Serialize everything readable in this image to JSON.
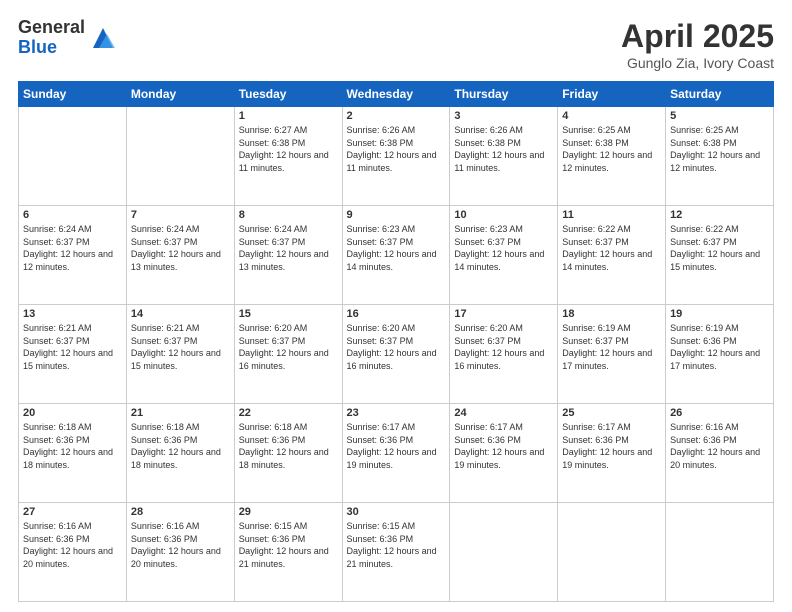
{
  "logo": {
    "general": "General",
    "blue": "Blue"
  },
  "header": {
    "month": "April 2025",
    "location": "Gunglo Zia, Ivory Coast"
  },
  "weekdays": [
    "Sunday",
    "Monday",
    "Tuesday",
    "Wednesday",
    "Thursday",
    "Friday",
    "Saturday"
  ],
  "weeks": [
    [
      {
        "day": "",
        "sunrise": "",
        "sunset": "",
        "daylight": ""
      },
      {
        "day": "",
        "sunrise": "",
        "sunset": "",
        "daylight": ""
      },
      {
        "day": "1",
        "sunrise": "Sunrise: 6:27 AM",
        "sunset": "Sunset: 6:38 PM",
        "daylight": "Daylight: 12 hours and 11 minutes."
      },
      {
        "day": "2",
        "sunrise": "Sunrise: 6:26 AM",
        "sunset": "Sunset: 6:38 PM",
        "daylight": "Daylight: 12 hours and 11 minutes."
      },
      {
        "day": "3",
        "sunrise": "Sunrise: 6:26 AM",
        "sunset": "Sunset: 6:38 PM",
        "daylight": "Daylight: 12 hours and 11 minutes."
      },
      {
        "day": "4",
        "sunrise": "Sunrise: 6:25 AM",
        "sunset": "Sunset: 6:38 PM",
        "daylight": "Daylight: 12 hours and 12 minutes."
      },
      {
        "day": "5",
        "sunrise": "Sunrise: 6:25 AM",
        "sunset": "Sunset: 6:38 PM",
        "daylight": "Daylight: 12 hours and 12 minutes."
      }
    ],
    [
      {
        "day": "6",
        "sunrise": "Sunrise: 6:24 AM",
        "sunset": "Sunset: 6:37 PM",
        "daylight": "Daylight: 12 hours and 12 minutes."
      },
      {
        "day": "7",
        "sunrise": "Sunrise: 6:24 AM",
        "sunset": "Sunset: 6:37 PM",
        "daylight": "Daylight: 12 hours and 13 minutes."
      },
      {
        "day": "8",
        "sunrise": "Sunrise: 6:24 AM",
        "sunset": "Sunset: 6:37 PM",
        "daylight": "Daylight: 12 hours and 13 minutes."
      },
      {
        "day": "9",
        "sunrise": "Sunrise: 6:23 AM",
        "sunset": "Sunset: 6:37 PM",
        "daylight": "Daylight: 12 hours and 14 minutes."
      },
      {
        "day": "10",
        "sunrise": "Sunrise: 6:23 AM",
        "sunset": "Sunset: 6:37 PM",
        "daylight": "Daylight: 12 hours and 14 minutes."
      },
      {
        "day": "11",
        "sunrise": "Sunrise: 6:22 AM",
        "sunset": "Sunset: 6:37 PM",
        "daylight": "Daylight: 12 hours and 14 minutes."
      },
      {
        "day": "12",
        "sunrise": "Sunrise: 6:22 AM",
        "sunset": "Sunset: 6:37 PM",
        "daylight": "Daylight: 12 hours and 15 minutes."
      }
    ],
    [
      {
        "day": "13",
        "sunrise": "Sunrise: 6:21 AM",
        "sunset": "Sunset: 6:37 PM",
        "daylight": "Daylight: 12 hours and 15 minutes."
      },
      {
        "day": "14",
        "sunrise": "Sunrise: 6:21 AM",
        "sunset": "Sunset: 6:37 PM",
        "daylight": "Daylight: 12 hours and 15 minutes."
      },
      {
        "day": "15",
        "sunrise": "Sunrise: 6:20 AM",
        "sunset": "Sunset: 6:37 PM",
        "daylight": "Daylight: 12 hours and 16 minutes."
      },
      {
        "day": "16",
        "sunrise": "Sunrise: 6:20 AM",
        "sunset": "Sunset: 6:37 PM",
        "daylight": "Daylight: 12 hours and 16 minutes."
      },
      {
        "day": "17",
        "sunrise": "Sunrise: 6:20 AM",
        "sunset": "Sunset: 6:37 PM",
        "daylight": "Daylight: 12 hours and 16 minutes."
      },
      {
        "day": "18",
        "sunrise": "Sunrise: 6:19 AM",
        "sunset": "Sunset: 6:37 PM",
        "daylight": "Daylight: 12 hours and 17 minutes."
      },
      {
        "day": "19",
        "sunrise": "Sunrise: 6:19 AM",
        "sunset": "Sunset: 6:36 PM",
        "daylight": "Daylight: 12 hours and 17 minutes."
      }
    ],
    [
      {
        "day": "20",
        "sunrise": "Sunrise: 6:18 AM",
        "sunset": "Sunset: 6:36 PM",
        "daylight": "Daylight: 12 hours and 18 minutes."
      },
      {
        "day": "21",
        "sunrise": "Sunrise: 6:18 AM",
        "sunset": "Sunset: 6:36 PM",
        "daylight": "Daylight: 12 hours and 18 minutes."
      },
      {
        "day": "22",
        "sunrise": "Sunrise: 6:18 AM",
        "sunset": "Sunset: 6:36 PM",
        "daylight": "Daylight: 12 hours and 18 minutes."
      },
      {
        "day": "23",
        "sunrise": "Sunrise: 6:17 AM",
        "sunset": "Sunset: 6:36 PM",
        "daylight": "Daylight: 12 hours and 19 minutes."
      },
      {
        "day": "24",
        "sunrise": "Sunrise: 6:17 AM",
        "sunset": "Sunset: 6:36 PM",
        "daylight": "Daylight: 12 hours and 19 minutes."
      },
      {
        "day": "25",
        "sunrise": "Sunrise: 6:17 AM",
        "sunset": "Sunset: 6:36 PM",
        "daylight": "Daylight: 12 hours and 19 minutes."
      },
      {
        "day": "26",
        "sunrise": "Sunrise: 6:16 AM",
        "sunset": "Sunset: 6:36 PM",
        "daylight": "Daylight: 12 hours and 20 minutes."
      }
    ],
    [
      {
        "day": "27",
        "sunrise": "Sunrise: 6:16 AM",
        "sunset": "Sunset: 6:36 PM",
        "daylight": "Daylight: 12 hours and 20 minutes."
      },
      {
        "day": "28",
        "sunrise": "Sunrise: 6:16 AM",
        "sunset": "Sunset: 6:36 PM",
        "daylight": "Daylight: 12 hours and 20 minutes."
      },
      {
        "day": "29",
        "sunrise": "Sunrise: 6:15 AM",
        "sunset": "Sunset: 6:36 PM",
        "daylight": "Daylight: 12 hours and 21 minutes."
      },
      {
        "day": "30",
        "sunrise": "Sunrise: 6:15 AM",
        "sunset": "Sunset: 6:36 PM",
        "daylight": "Daylight: 12 hours and 21 minutes."
      },
      {
        "day": "",
        "sunrise": "",
        "sunset": "",
        "daylight": ""
      },
      {
        "day": "",
        "sunrise": "",
        "sunset": "",
        "daylight": ""
      },
      {
        "day": "",
        "sunrise": "",
        "sunset": "",
        "daylight": ""
      }
    ]
  ]
}
